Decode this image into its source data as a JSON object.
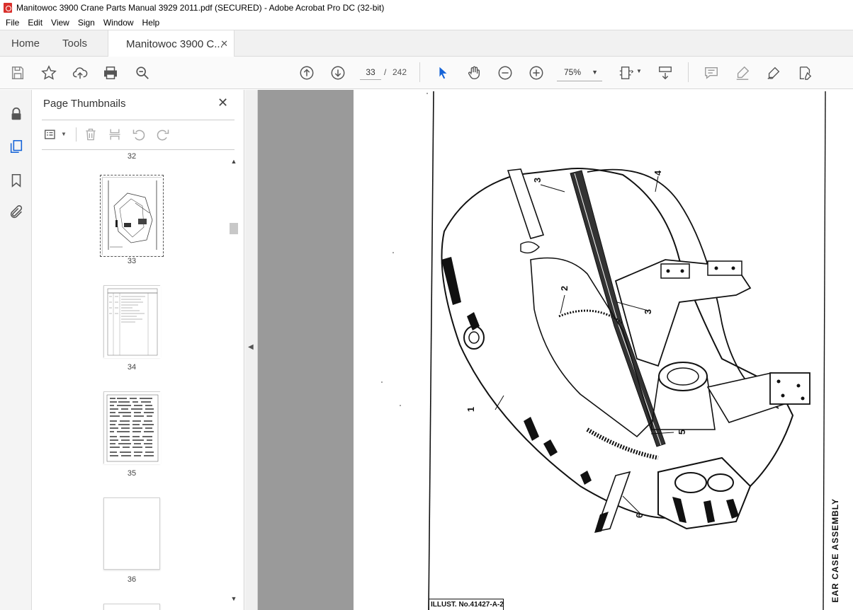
{
  "window": {
    "title": "Manitowoc 3900 Crane Parts Manual 3929 2011.pdf (SECURED) - Adobe Acrobat Pro DC (32-bit)"
  },
  "menu": [
    "File",
    "Edit",
    "View",
    "Sign",
    "Window",
    "Help"
  ],
  "tabs": {
    "home": "Home",
    "tools": "Tools",
    "document": "Manitowoc 3900 C..."
  },
  "toolbar": {
    "current_page": "33",
    "page_separator": "/",
    "total_pages": "242",
    "zoom": "75%"
  },
  "panel": {
    "title": "Page Thumbnails",
    "thumbnails": [
      {
        "label": "32"
      },
      {
        "label": "33"
      },
      {
        "label": "34"
      },
      {
        "label": "35"
      },
      {
        "label": "36"
      }
    ]
  },
  "drawing": {
    "callouts": [
      "1",
      "2",
      "3",
      "3",
      "4",
      "5",
      "6"
    ],
    "caption": "EAR CASE ASSEMBLY",
    "illustration_number": "ILLUST. No.41427-A-2"
  }
}
